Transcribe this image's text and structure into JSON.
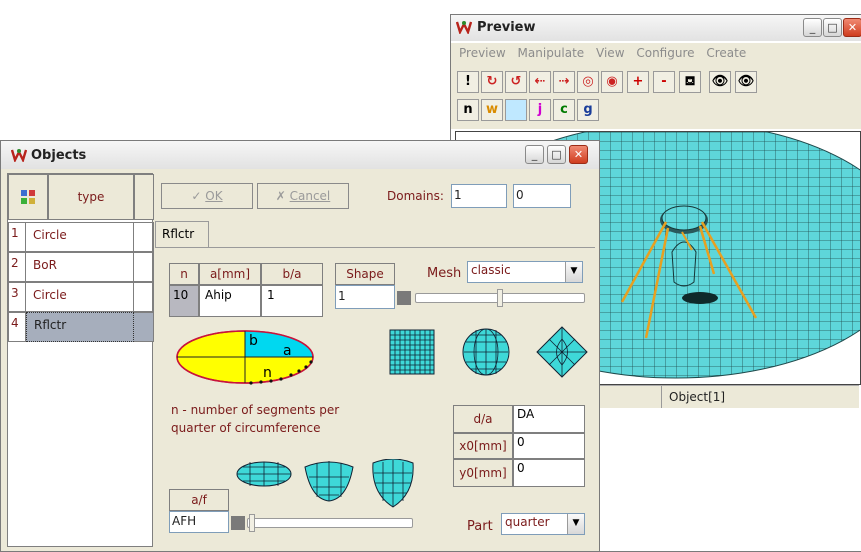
{
  "preview": {
    "title": "Preview",
    "menu": [
      "Preview",
      "Manipulate",
      "View",
      "Configure",
      "Create"
    ],
    "toolbar1": [
      "!",
      "rotate-x-icon",
      "rotate-y-icon",
      "rotate-left-icon",
      "rotate-right-icon",
      "zoom-icon",
      "zoom-out-icon",
      "+",
      "-",
      "paint-bucket-icon",
      "eye-plus-icon",
      "eye-color-icon"
    ],
    "toolbar2": [
      "n",
      "w",
      "",
      "j",
      "c",
      "g"
    ],
    "toolbar2_colors": [
      "#000000",
      "#d98b00",
      "#9fd7ff",
      "#d000d0",
      "#007a00",
      "#1a3d9a"
    ],
    "status": "Object[1]",
    "mesh_color": "#52d8dc",
    "feed_color": "#e8a020"
  },
  "objects": {
    "title": "Objects",
    "list_header": "type",
    "rows": [
      {
        "num": "1",
        "type": "Circle"
      },
      {
        "num": "2",
        "type": "BoR"
      },
      {
        "num": "3",
        "type": "Circle"
      },
      {
        "num": "4",
        "type": "Rflctr"
      }
    ],
    "ok_label": "OK",
    "cancel_label": "Cancel",
    "domains_label": "Domains:",
    "domain1": "1",
    "domain2": "0",
    "tab_label": "Rflctr",
    "table": {
      "headers": [
        "n",
        "a[mm]",
        "b/a"
      ],
      "values": [
        "10",
        "Ahip",
        "1"
      ]
    },
    "shape_label": "Shape",
    "shape_value": "1",
    "mesh_label": "Mesh",
    "mesh_value": "classic",
    "ellipse_labels": {
      "b": "b",
      "a": "a",
      "n": "n"
    },
    "description": [
      "n -  number of  segments per",
      "quarter of circumference"
    ],
    "params": {
      "da_label": "d/a",
      "da_value": "DA",
      "x0_label": "x0[mm]",
      "x0_value": "0",
      "y0_label": "y0[mm]",
      "y0_value": "0"
    },
    "af_label": "a/f",
    "af_value": "AFH",
    "part_label": "Part",
    "part_value": "quarter",
    "ellipse_colors": {
      "fill": "#ffff00",
      "accent": "#00d8f0",
      "outline": "#c8143c"
    },
    "shape_color": "#3ed8d8"
  }
}
